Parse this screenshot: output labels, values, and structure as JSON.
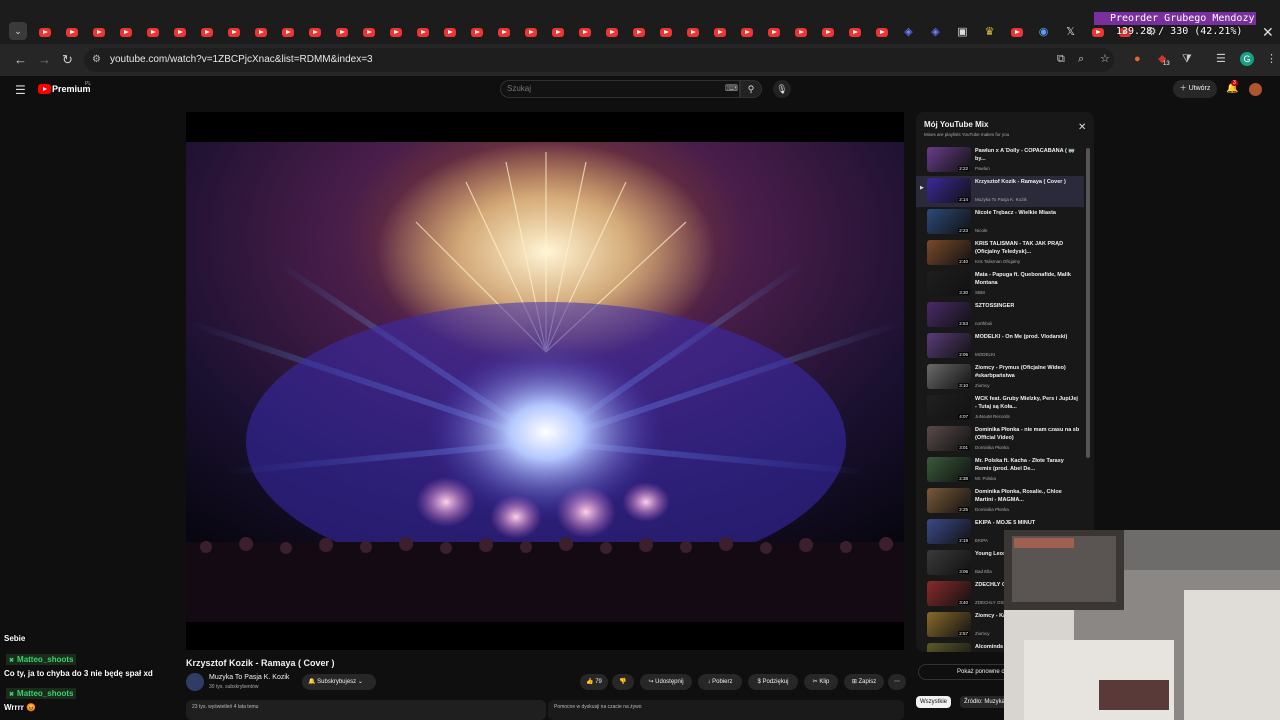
{
  "browser": {
    "tabs": [
      "youtube",
      "youtube",
      "youtube",
      "youtube",
      "youtube",
      "youtube",
      "youtube",
      "youtube",
      "youtube",
      "youtube",
      "youtube",
      "youtube",
      "youtube",
      "youtube",
      "youtube",
      "youtube",
      "youtube",
      "youtube",
      "youtube",
      "youtube",
      "youtube",
      "youtube",
      "youtube",
      "youtube",
      "youtube",
      "youtube",
      "youtube",
      "youtube",
      "youtube",
      "youtube",
      "youtube",
      "youtube",
      "extension",
      "extension",
      "video",
      "crown",
      "youtube",
      "globe",
      "x",
      "youtube",
      "youtube",
      "settings"
    ],
    "url": "youtube.com/watch?v=1ZBCPjcXnac&list=RDMM&index=3",
    "icons": [
      "tab-menu-icon",
      "back-icon",
      "forward-icon",
      "reload-icon",
      "site-info-icon",
      "cast-icon",
      "zoom-icon",
      "bookmark-star-icon",
      "extension-icon",
      "puzzle-icon",
      "reading-list-icon",
      "profile-icon",
      "kebab-menu-icon",
      "close-icon"
    ],
    "profile_initial": "G",
    "extension_badge": "13"
  },
  "stream_overlay": {
    "preorder": "Preorder Grubego Mendozy",
    "counter": "139.28 / 330 (42.21%)"
  },
  "youtube": {
    "brand": "Premium",
    "country": "PL",
    "search_placeholder": "Szukaj",
    "create_label": "Utwórz",
    "notifications_count": "3"
  },
  "video": {
    "title": "Krzysztof Kozik - Ramaya ( Cover )",
    "channel": "Muzyka To Pasja K. Kozik",
    "subscribers": "30 tys. subskrybentów",
    "subscribe_label": "Subskrybujesz",
    "likes": "79",
    "actions": [
      "Udostępnij",
      "Pobierz",
      "Podziękuj",
      "Klip",
      "Zapisz"
    ],
    "description_preview": "23 tys. wyświetleń  4 lata temu",
    "chat_replay_preview": "Pomocne w dyskusji na czacie na żywo"
  },
  "mix": {
    "title": "Mój YouTube Mix",
    "subtitle": "Mixes are playlists YouTube makes for you",
    "save_label": "Pokaż ponowne odtworzenie",
    "items": [
      {
        "title": "Pawlun x A`Dolly - COPACABANA ( 🥽 by...",
        "channel": "Pawlun",
        "duration": "2:22",
        "active": false
      },
      {
        "title": "Krzysztof Kozik - Ramaya ( Cover )",
        "channel": "Muzyka To Pasja K. Kozik",
        "duration": "2:14",
        "active": true
      },
      {
        "title": "Nicole Trębacz - Wielkie Miasta",
        "channel": "Nicole",
        "duration": "2:23",
        "active": false
      },
      {
        "title": "KRIS TALISMAN - TAK JAK PRĄD (Oficjalny Teledysk)...",
        "channel": "Kris Talisman Oficjalny",
        "duration": "2:40",
        "active": false
      },
      {
        "title": "Mata - Papuga ft. Quebonafide, Malik Montana",
        "channel": "SBM",
        "duration": "3:30",
        "active": false
      },
      {
        "title": "SZTOSSINGER",
        "channel": "northboii",
        "duration": "2:53",
        "active": false
      },
      {
        "title": "MODELKI - On Me (prod. Vlodarski)",
        "channel": "MODELKI",
        "duration": "2:06",
        "active": false
      },
      {
        "title": "Ziomcy - Prymus (Oficjalne Wideo) #skarbpaństwa",
        "channel": "Ziomcy",
        "duration": "3:10",
        "active": false
      },
      {
        "title": "WCK feat. Gruby Mielzky, Pers i JupiJej - Tutaj są Koła...",
        "channel": "JuNouM Records",
        "duration": "4:07",
        "active": false
      },
      {
        "title": "Dominika Płonka - nie mam czasu na sb (Official Video)",
        "channel": "Dominika Płonka",
        "duration": "3:01",
        "active": false
      },
      {
        "title": "Mr. Polska ft. Kacha - Złote Tarasy Remix (prod. Abel De...",
        "channel": "Mr. Polska",
        "duration": "2:38",
        "active": false
      },
      {
        "title": "Dominika Płonka, Rosalie., Chloe Martini - MAGMA...",
        "channel": "Dominika Płonka",
        "duration": "2:25",
        "active": false
      },
      {
        "title": "EKIPA - MOJE 5 MINUT",
        "channel": "EKIPA",
        "duration": "2:19",
        "active": false
      },
      {
        "title": "Young Leosia - PGS",
        "channel": "Bad Ella",
        "duration": "3:06",
        "active": false
      },
      {
        "title": "ZDECHLY OSIOL - DO WIDZENIA",
        "channel": "ZDECHLY OSIOL",
        "duration": "3:40",
        "active": false
      },
      {
        "title": "Ziomcy - Kajzer)",
        "channel": "Ziomcy",
        "duration": "2:57",
        "active": false
      },
      {
        "title": "Alcominds",
        "channel": "",
        "duration": "",
        "active": false
      }
    ],
    "chips": [
      "Wszystkie",
      "Źródło: Muzyka"
    ]
  },
  "chat": {
    "header": "Sebie",
    "messages": [
      {
        "user": "Matteo_shoots",
        "text": "Co ty, ja to chyba do 3 nie będę spał xd"
      },
      {
        "user": "Matteo_shoots",
        "text": "Wrrrr 😡"
      }
    ]
  }
}
